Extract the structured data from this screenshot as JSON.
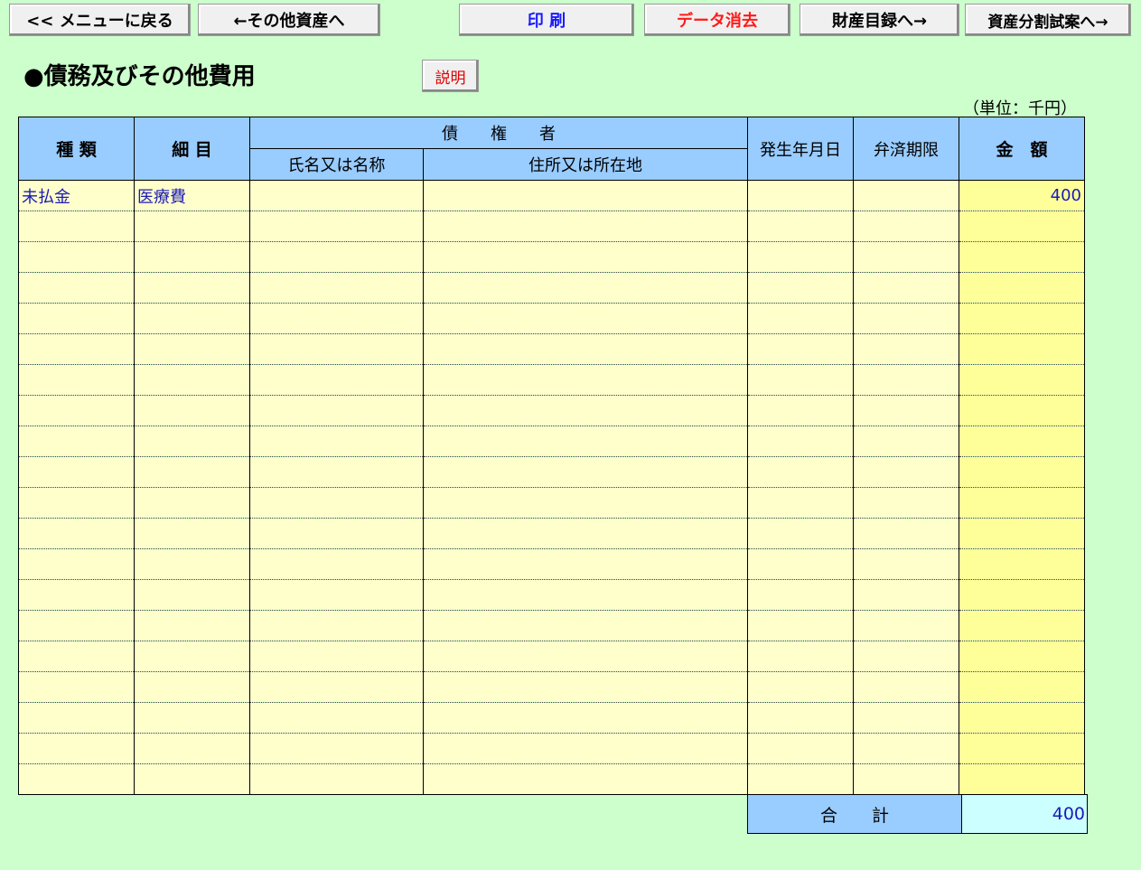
{
  "toolbar": {
    "back_menu": "<< メニューに戻る",
    "prev_assets": "←その他資産へ",
    "print": "印 刷",
    "clear_data": "データ消去",
    "inventory": "財産目録へ→",
    "division_plan": "資産分割試案へ→"
  },
  "page": {
    "title": "●債務及びその他費用",
    "help": "説明",
    "unit": "（単位：千円）"
  },
  "table": {
    "headers": {
      "kind": "種 類",
      "item": "細 目",
      "creditor": "債　　権　　者",
      "name": "氏名又は名称",
      "address": "住所又は所在地",
      "date": "発生年月日",
      "due": "弁済期限",
      "amount": "金　額"
    },
    "rows": [
      {
        "kind": "未払金",
        "item": "医療費",
        "name": "",
        "address": "",
        "date": "",
        "due": "",
        "amount": "400"
      },
      {
        "kind": "",
        "item": "",
        "name": "",
        "address": "",
        "date": "",
        "due": "",
        "amount": ""
      },
      {
        "kind": "",
        "item": "",
        "name": "",
        "address": "",
        "date": "",
        "due": "",
        "amount": ""
      },
      {
        "kind": "",
        "item": "",
        "name": "",
        "address": "",
        "date": "",
        "due": "",
        "amount": ""
      },
      {
        "kind": "",
        "item": "",
        "name": "",
        "address": "",
        "date": "",
        "due": "",
        "amount": ""
      },
      {
        "kind": "",
        "item": "",
        "name": "",
        "address": "",
        "date": "",
        "due": "",
        "amount": ""
      },
      {
        "kind": "",
        "item": "",
        "name": "",
        "address": "",
        "date": "",
        "due": "",
        "amount": ""
      },
      {
        "kind": "",
        "item": "",
        "name": "",
        "address": "",
        "date": "",
        "due": "",
        "amount": ""
      },
      {
        "kind": "",
        "item": "",
        "name": "",
        "address": "",
        "date": "",
        "due": "",
        "amount": ""
      },
      {
        "kind": "",
        "item": "",
        "name": "",
        "address": "",
        "date": "",
        "due": "",
        "amount": ""
      },
      {
        "kind": "",
        "item": "",
        "name": "",
        "address": "",
        "date": "",
        "due": "",
        "amount": ""
      },
      {
        "kind": "",
        "item": "",
        "name": "",
        "address": "",
        "date": "",
        "due": "",
        "amount": ""
      },
      {
        "kind": "",
        "item": "",
        "name": "",
        "address": "",
        "date": "",
        "due": "",
        "amount": ""
      },
      {
        "kind": "",
        "item": "",
        "name": "",
        "address": "",
        "date": "",
        "due": "",
        "amount": ""
      },
      {
        "kind": "",
        "item": "",
        "name": "",
        "address": "",
        "date": "",
        "due": "",
        "amount": ""
      },
      {
        "kind": "",
        "item": "",
        "name": "",
        "address": "",
        "date": "",
        "due": "",
        "amount": ""
      },
      {
        "kind": "",
        "item": "",
        "name": "",
        "address": "",
        "date": "",
        "due": "",
        "amount": ""
      },
      {
        "kind": "",
        "item": "",
        "name": "",
        "address": "",
        "date": "",
        "due": "",
        "amount": ""
      },
      {
        "kind": "",
        "item": "",
        "name": "",
        "address": "",
        "date": "",
        "due": "",
        "amount": ""
      },
      {
        "kind": "",
        "item": "",
        "name": "",
        "address": "",
        "date": "",
        "due": "",
        "amount": ""
      }
    ],
    "total_label": "合　　計",
    "total_value": "400"
  }
}
